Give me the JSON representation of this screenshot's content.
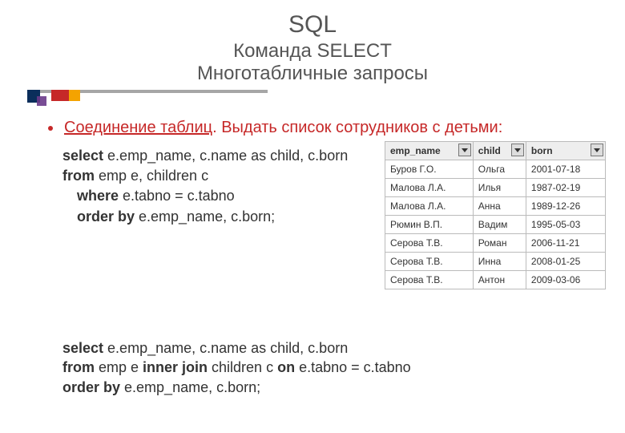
{
  "title": {
    "main": "SQL",
    "sub1": "Команда SELECT",
    "sub2": "Многотабличные запросы"
  },
  "bullet": {
    "underline": "Соединение таблиц",
    "rest": ". Выдать список сотрудников с детьми:"
  },
  "code1": {
    "l1a": "select",
    "l1b": " e.emp_name, c.name as child, c.born",
    "l2a": "from",
    "l2b": " emp e, children c",
    "l3a": "where",
    "l3b": " e.tabno = c.tabno",
    "l4a": "order by",
    "l4b": " e.emp_name, c.born;"
  },
  "code2": {
    "l1a": "select",
    "l1b": " e.emp_name, c.name as child, c.born",
    "l2a": "from",
    "l2b": " emp e ",
    "l2c": "inner join",
    "l2d": " children c  ",
    "l2e": "on",
    "l2f": " e.tabno = c.tabno",
    "l3a": "order by",
    "l3b": " e.emp_name, c.born;"
  },
  "table": {
    "headers": [
      "emp_name",
      "child",
      "born"
    ],
    "rows": [
      [
        "Буров Г.О.",
        "Ольга",
        "2001-07-18"
      ],
      [
        "Малова Л.А.",
        "Илья",
        "1987-02-19"
      ],
      [
        "Малова Л.А.",
        "Анна",
        "1989-12-26"
      ],
      [
        "Рюмин В.П.",
        "Вадим",
        "1995-05-03"
      ],
      [
        "Серова Т.В.",
        "Роман",
        "2006-11-21"
      ],
      [
        "Серова Т.В.",
        "Инна",
        "2008-01-25"
      ],
      [
        "Серова Т.В.",
        "Антон",
        "2009-03-06"
      ]
    ]
  }
}
